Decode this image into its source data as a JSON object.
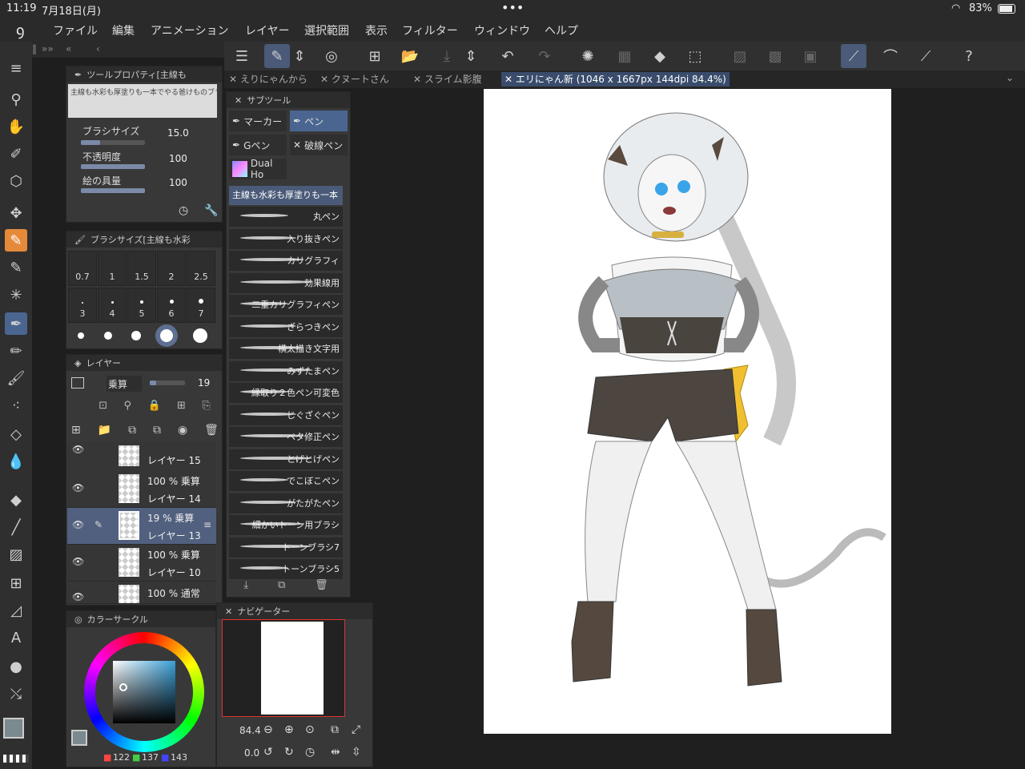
{
  "status": {
    "time": "11:19",
    "date": "7月18日(月)",
    "battery": "83%",
    "dots": "•••"
  },
  "menu": [
    "ファイル",
    "編集",
    "アニメーション",
    "レイヤー",
    "選択範囲",
    "表示",
    "フィルター",
    "ウィンドウ",
    "ヘルプ"
  ],
  "tabs": [
    "えりにゃんから",
    "クヌートさん",
    "スライム影腹",
    "エリにゃん新 (1046 x 1667px 144dpi 84.4%)"
  ],
  "tool_property": {
    "title": "ツールプロパティ[主線も",
    "preview_text": "主線も水彩も厚塗りも一本でやる爸けものブラ",
    "brush_size_label": "ブラシサイズ",
    "brush_size": "15.0",
    "opacity_label": "不透明度",
    "opacity": "100",
    "paint_amount_label": "絵の具量",
    "paint_amount": "100"
  },
  "brush_size_panel": {
    "title": "ブラシサイズ[主線も水彩",
    "sizes": [
      "0.7",
      "1",
      "1.5",
      "2",
      "2.5",
      "3",
      "4",
      "5",
      "6",
      "7"
    ]
  },
  "layer_panel": {
    "title": "レイヤー",
    "blend": "乗算",
    "opacity": "19",
    "layers": [
      {
        "name": "レイヤー 15",
        "info": ""
      },
      {
        "name": "レイヤー 14",
        "info": "100 % 乗算"
      },
      {
        "name": "レイヤー 13",
        "info": "19 % 乗算"
      },
      {
        "name": "レイヤー 10",
        "info": "100 % 乗算"
      },
      {
        "name": "",
        "info": "100 % 通常"
      }
    ]
  },
  "color_circle": {
    "title": "カラーサークル",
    "r": "122",
    "g": "137",
    "b": "143"
  },
  "subtool": {
    "title": "サブツール",
    "groups": [
      "マーカー",
      "ペン",
      "Gペン",
      "破線ペン",
      "Dual Ho"
    ],
    "category": "主線も水彩も厚塗りも一本",
    "brushes": [
      "丸ペン",
      "入り抜きペン",
      "カリグラフィ",
      "効果線用",
      "二重カリグラフィペン",
      "ざらつきペン",
      "横太描き文字用",
      "みずたまペン",
      "縁取り２色ペン可変色",
      "じぐざぐペン",
      "ベタ修正ペン",
      "とげとげペン",
      "でこぼこペン",
      "がたがたペン",
      "細かいトーン用ブラシ",
      "トーンブラシ7",
      "トーンブラシ5"
    ]
  },
  "navigator": {
    "title": "ナビゲーター",
    "zoom": "84.4",
    "angle": "0.0"
  }
}
